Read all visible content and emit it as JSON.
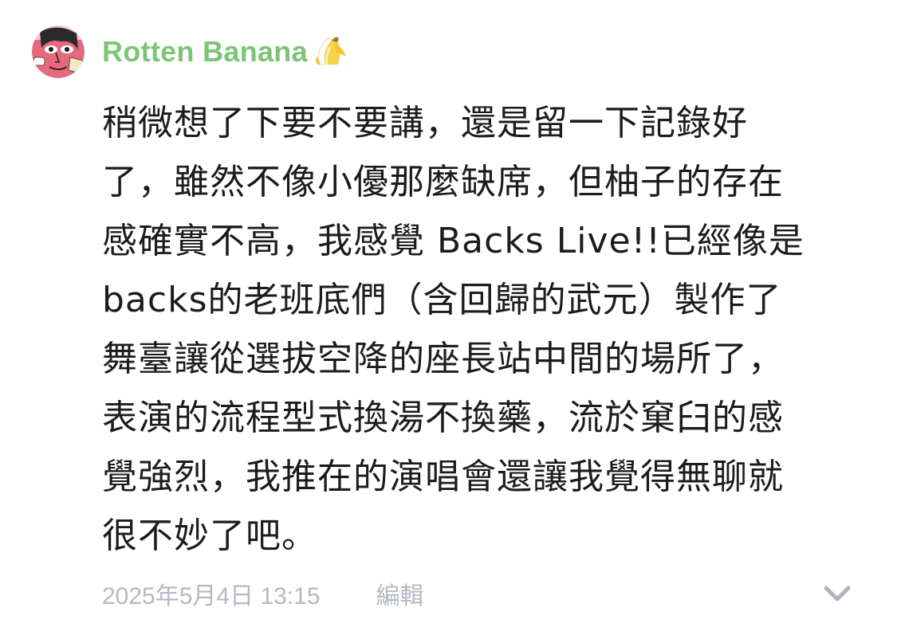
{
  "post": {
    "author": {
      "name": "Rotten Banana",
      "emoji": "banana-icon",
      "name_color": "#7cc576"
    },
    "content": "稍微想了下要不要講，還是留一下記錄好\n了，雖然不像小優那麼缺席，但柚子的存在\n感確實不高，我感覺 Backs Live!!已經像是\nbacks的老班底們（含回歸的武元）製作了\n舞臺讓從選拔空降的座長站中間的場所了，\n表演的流程型式換湯不換藥，流於窠臼的感\n覺強烈，我推在的演唱會還讓我覺得無聊就\n很不妙了吧。",
    "timestamp": "2025年5月4日 13:15",
    "edit_label": "編輯",
    "expand_icon": "chevron-down-icon"
  }
}
